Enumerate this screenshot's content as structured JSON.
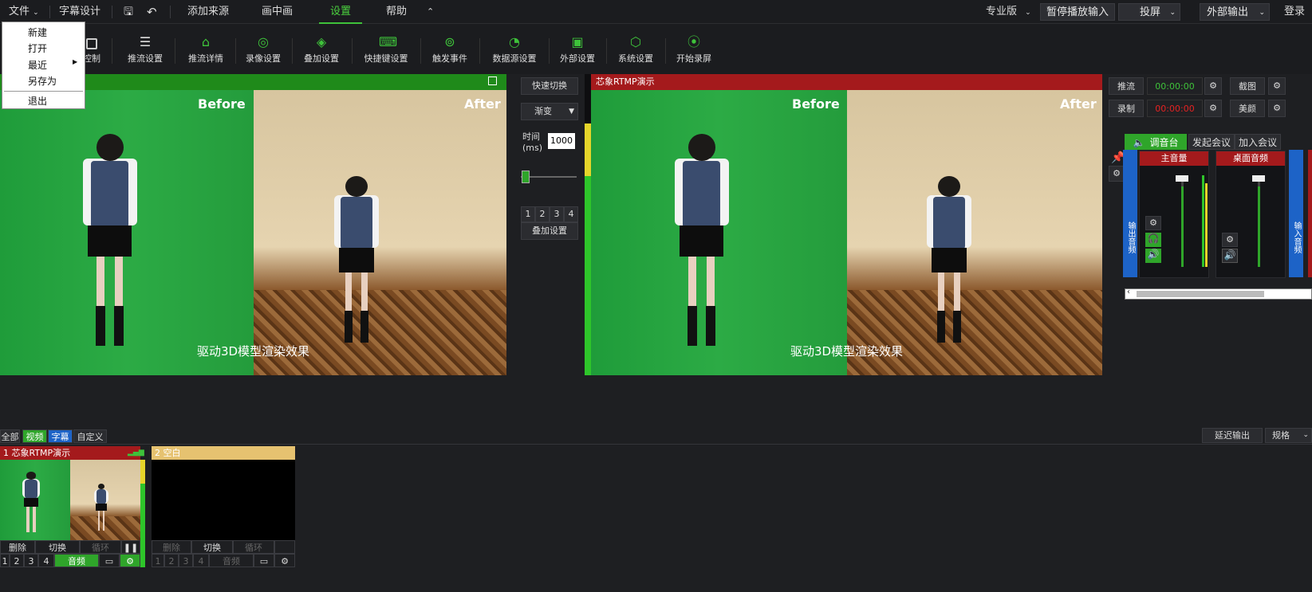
{
  "menubar": {
    "file": "文件",
    "subtitle_design": "字幕设计",
    "add_source": "添加来源",
    "pip": "画中画",
    "settings": "设置",
    "help": "帮助",
    "edition": "专业版",
    "pause_input": "暂停播放输入",
    "cast": "投屏",
    "external_output": "外部输出",
    "login": "登录"
  },
  "file_menu": {
    "new": "新建",
    "open": "打开",
    "recent": "最近",
    "save_as": "另存为",
    "exit": "退出"
  },
  "toolbar": {
    "control": "控制",
    "push_settings": "推流设置",
    "push_details": "推流详情",
    "record_settings": "录像设置",
    "overlay_settings": "叠加设置",
    "hotkey_settings": "快捷键设置",
    "trigger_events": "触发事件",
    "datasource_settings": "数据源设置",
    "external_settings": "外部设置",
    "system_settings": "系统设置",
    "start_screen_record": "开始录屏"
  },
  "preview": {
    "before": "Before",
    "after": "After",
    "caption": "驱动3D模型渲染效果"
  },
  "program": {
    "title": "芯象RTMP演示",
    "before": "Before",
    "after": "After",
    "caption": "驱动3D模型渲染效果"
  },
  "transition": {
    "quick_switch": "快速切换",
    "mode": "渐变",
    "time_label": "时间\n(ms)",
    "time_value": "1000",
    "nums": [
      "1",
      "2",
      "3",
      "4"
    ],
    "overlay": "叠加设置"
  },
  "right": {
    "push": "推流",
    "push_time": "00:00:00",
    "record": "录制",
    "record_time": "00:00:00",
    "screenshot": "截图",
    "beauty": "美颜"
  },
  "mixer": {
    "tabs": [
      "调音台",
      "发起会议",
      "加入会议"
    ],
    "main_volume": "主音量",
    "desktop_audio": "桌面音频",
    "output_audio": "输出音频",
    "input_audio": "输入音频"
  },
  "filters": [
    "全部",
    "视频",
    "字幕",
    "自定义"
  ],
  "bottom_right": {
    "delay_output": "延迟输出",
    "spec": "规格"
  },
  "tiles": [
    {
      "title": "1 芯象RTMP演示",
      "delete": "删除",
      "switch": "切换",
      "loop": "循环",
      "audio": "音频"
    },
    {
      "title": "2 空白",
      "delete": "删除",
      "switch": "切换",
      "loop": "循环",
      "audio": "音频"
    }
  ],
  "colors": {
    "accent": "#3ec23a",
    "red": "#a41a1c",
    "blue": "#1d63c7",
    "tile2": "#e6c270"
  }
}
